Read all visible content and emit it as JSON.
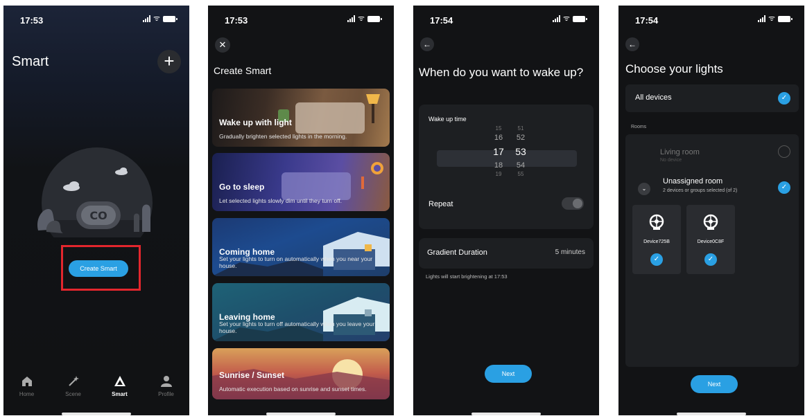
{
  "status": {
    "p1_time": "17:53",
    "p2_time": "17:53",
    "p3_time": "17:54",
    "p4_time": "17:54"
  },
  "smart": {
    "title": "Smart",
    "create_button": "Create Smart",
    "tabs": [
      {
        "label": "Home",
        "icon": "home-icon"
      },
      {
        "label": "Scene",
        "icon": "magic-wand-icon"
      },
      {
        "label": "Smart",
        "icon": "smart-icon"
      },
      {
        "label": "Profile",
        "icon": "profile-icon"
      }
    ]
  },
  "create": {
    "title": "Create Smart",
    "cards": [
      {
        "title": "Wake up with light",
        "desc": "Gradually brighten selected lights in the morning."
      },
      {
        "title": "Go to sleep",
        "desc": "Let selected lights slowly dim until they turn off."
      },
      {
        "title": "Coming home",
        "desc": "Set your lights to turn on automatically when you near your house."
      },
      {
        "title": "Leaving home",
        "desc": "Set your lights to turn off automatically when you leave your house."
      },
      {
        "title": "Sunrise / Sunset",
        "desc": "Automatic execution based on sunrise and sunset times."
      }
    ]
  },
  "wake": {
    "title": "When do you want to wake up?",
    "time_label": "Wake up time",
    "hours": [
      "15",
      "16",
      "17",
      "18",
      "19"
    ],
    "minutes": [
      "51",
      "52",
      "53",
      "54",
      "55"
    ],
    "repeat_label": "Repeat",
    "repeat_on": false,
    "gradient_label": "Gradient Duration",
    "gradient_value": "5 minutes",
    "note": "Lights will start brightening at 17:53",
    "next": "Next"
  },
  "lights": {
    "title": "Choose your lights",
    "all_devices": "All devices",
    "rooms_heading": "Rooms",
    "room1_name": "Living room",
    "room1_sub": "No device",
    "room2_name": "Unassigned room",
    "room2_sub": "2 devices or groups selected (of 2)",
    "devices": [
      "Device725B",
      "Device0C8F"
    ],
    "next": "Next"
  },
  "colors": {
    "accent": "#2aa0e3",
    "highlight": "#e3262d"
  }
}
